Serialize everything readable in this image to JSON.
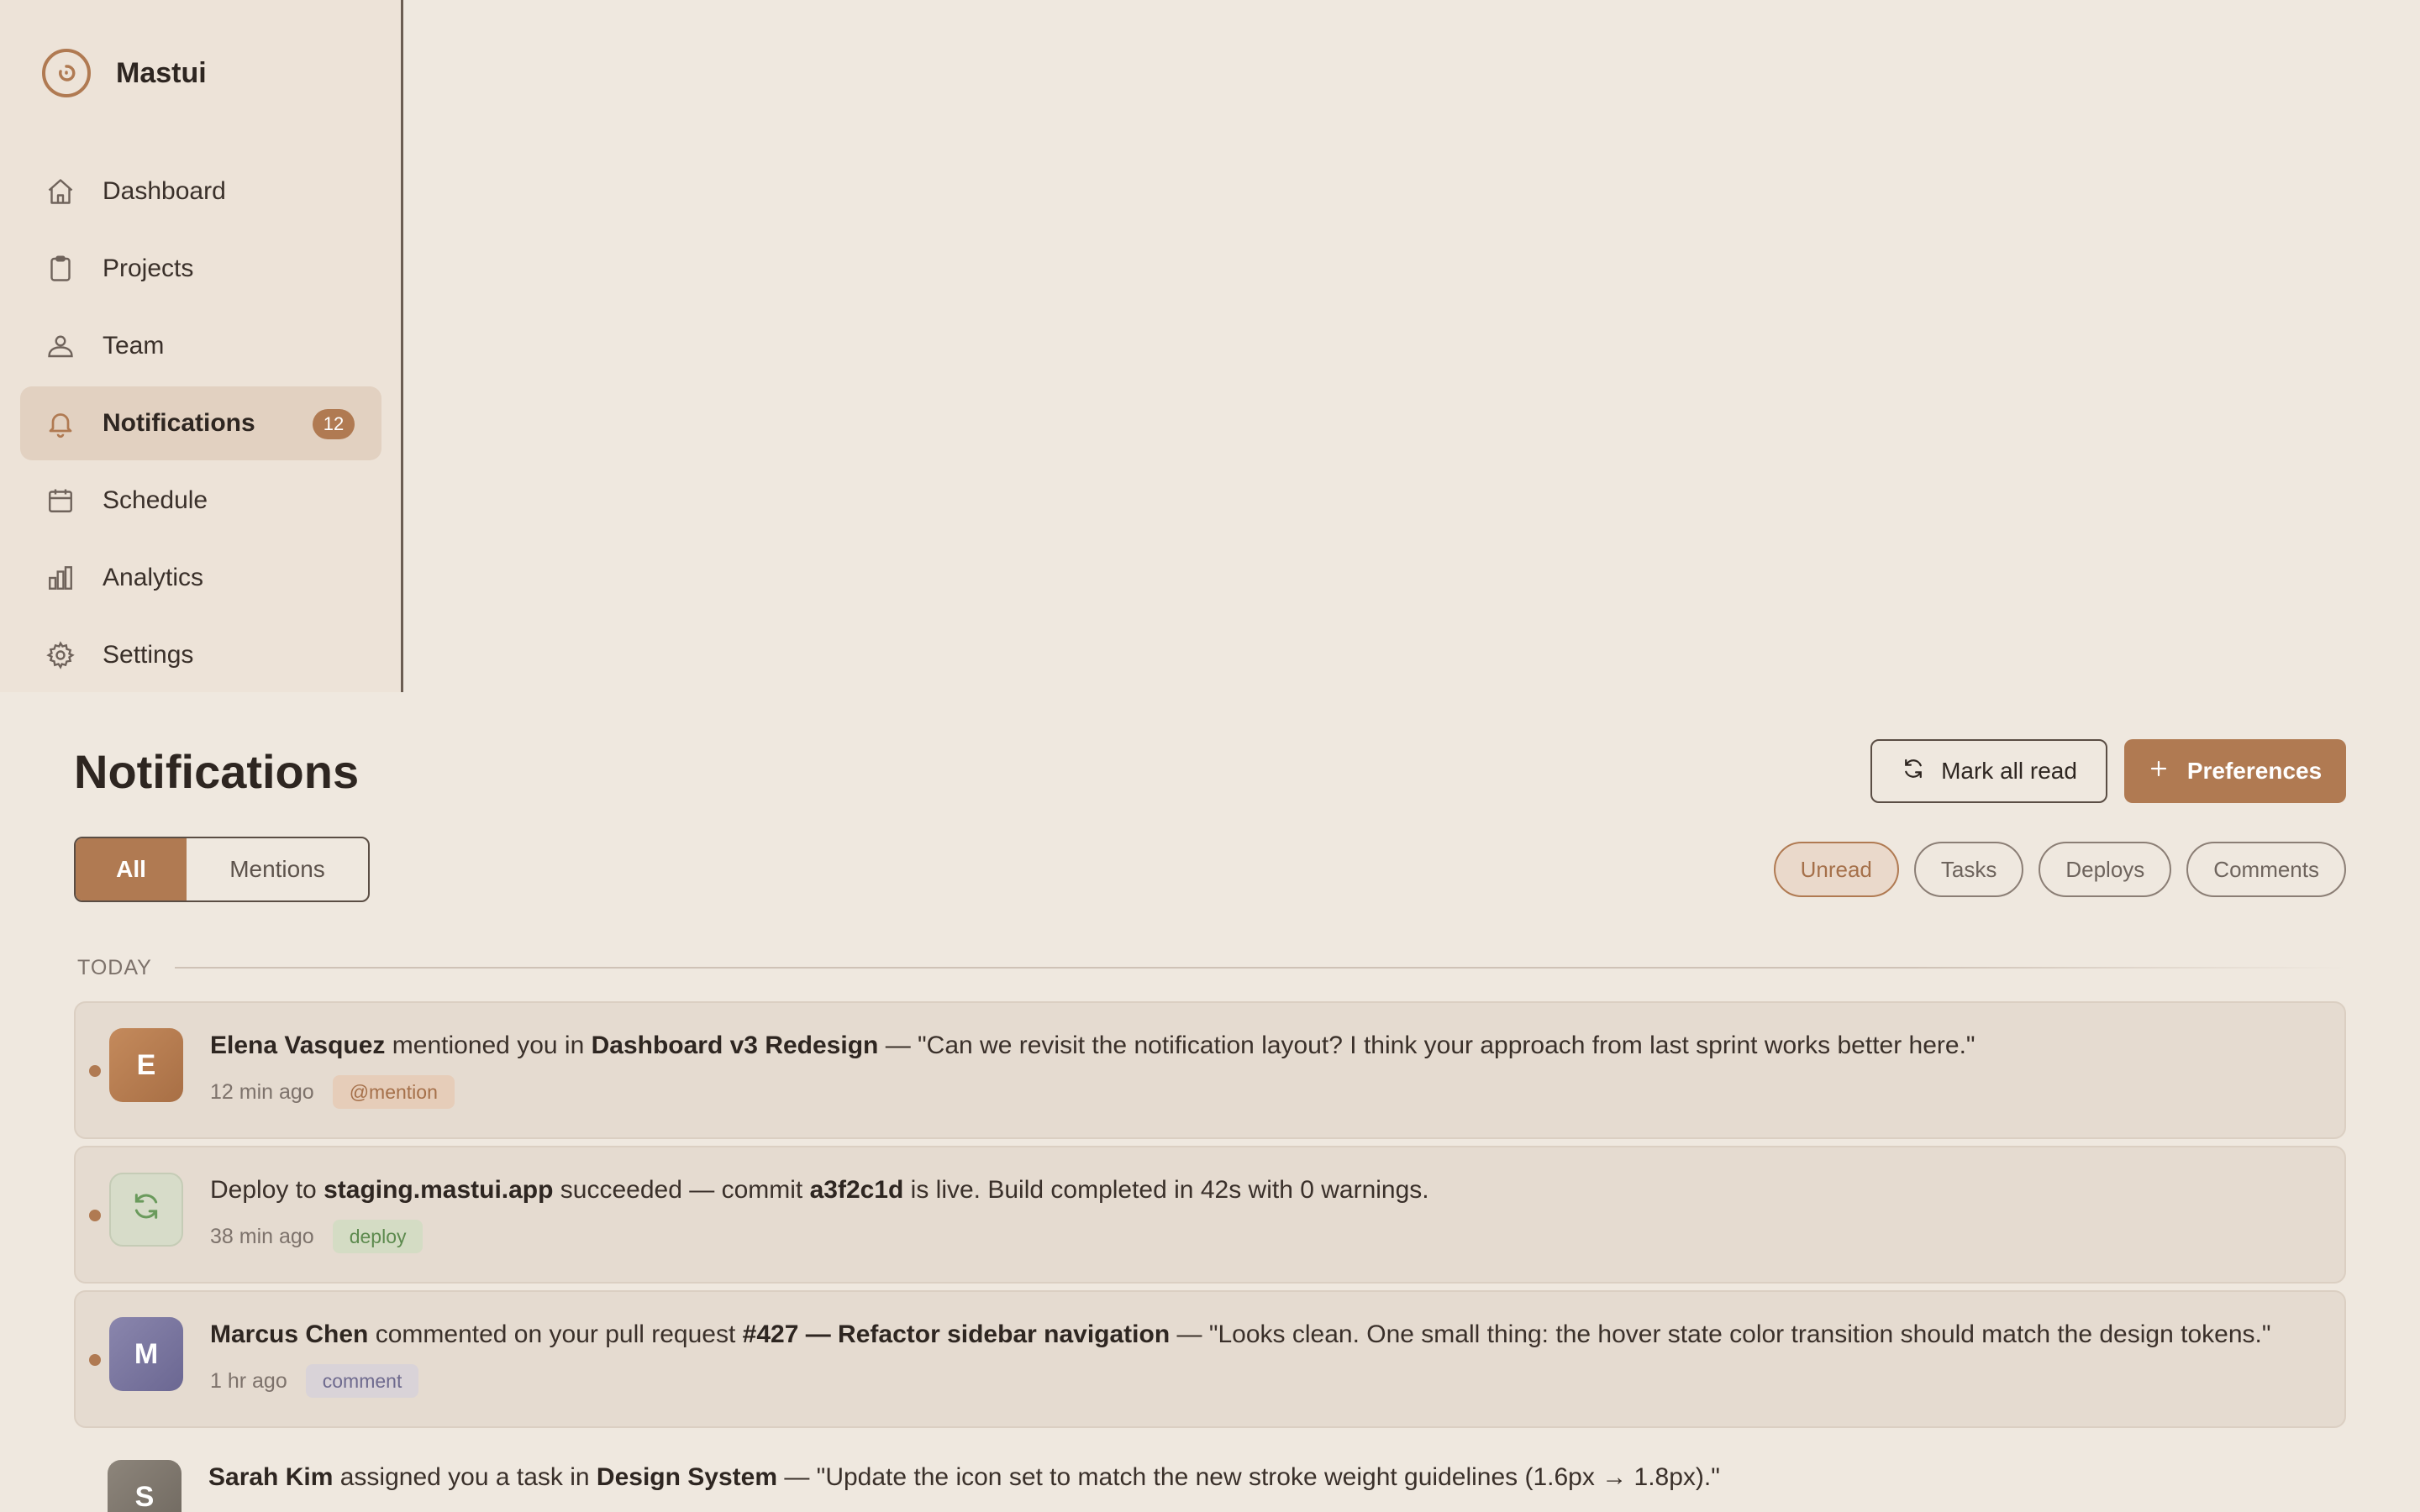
{
  "app": {
    "name": "Mastui"
  },
  "sidebar": {
    "items": [
      {
        "label": "Dashboard",
        "icon": "home-icon"
      },
      {
        "label": "Projects",
        "icon": "clipboard-icon"
      },
      {
        "label": "Team",
        "icon": "people-icon"
      },
      {
        "label": "Notifications",
        "icon": "bell-icon",
        "badge": "12",
        "active": true
      },
      {
        "label": "Schedule",
        "icon": "calendar-icon"
      },
      {
        "label": "Analytics",
        "icon": "bar-chart-icon"
      },
      {
        "label": "Settings",
        "icon": "gear-icon"
      }
    ]
  },
  "main": {
    "title": "Notifications",
    "mark_all_read_label": "Mark all read",
    "preferences_label": "Preferences",
    "segment": {
      "all": "All",
      "mentions": "Mentions"
    },
    "filters": [
      "Unread",
      "Tasks",
      "Deploys",
      "Comments"
    ],
    "section_label": "TODAY"
  },
  "notifications": [
    {
      "avatar": "E",
      "actor": "Elena Vasquez",
      "text1": " mentioned you in ",
      "target": "Dashboard v3 Redesign",
      "text2": " — \"Can we revisit the notification layout? I think your approach from last sprint works better here.\"",
      "time": "12 min ago",
      "tag": "@mention",
      "unread": true
    },
    {
      "avatar_icon": "refresh-icon",
      "prefix": "Deploy to ",
      "target": "staging.mastui.app",
      "text1": " succeeded — commit ",
      "commit": "a3f2c1d",
      "text2": " is live. Build completed in 42s with 0 warnings.",
      "time": "38 min ago",
      "tag": "deploy",
      "unread": true
    },
    {
      "avatar": "M",
      "actor": "Marcus Chen",
      "text1": " commented on your pull request ",
      "target": "#427 — Refactor sidebar navigation",
      "text2": " — \"Looks clean. One small thing: the hover state color transition should match the design tokens.\"",
      "time": "1 hr ago",
      "tag": "comment",
      "unread": true
    },
    {
      "avatar": "S",
      "actor": "Sarah Kim",
      "text1": " assigned you a task in ",
      "target": "Design System",
      "text2": " — \"Update the icon set to match the new stroke weight guidelines (1.6px → 1.8px).\""
    }
  ],
  "colors": {
    "accent": "#b07a52",
    "background": "#efe8df",
    "sidebar": "#ede3d8"
  }
}
